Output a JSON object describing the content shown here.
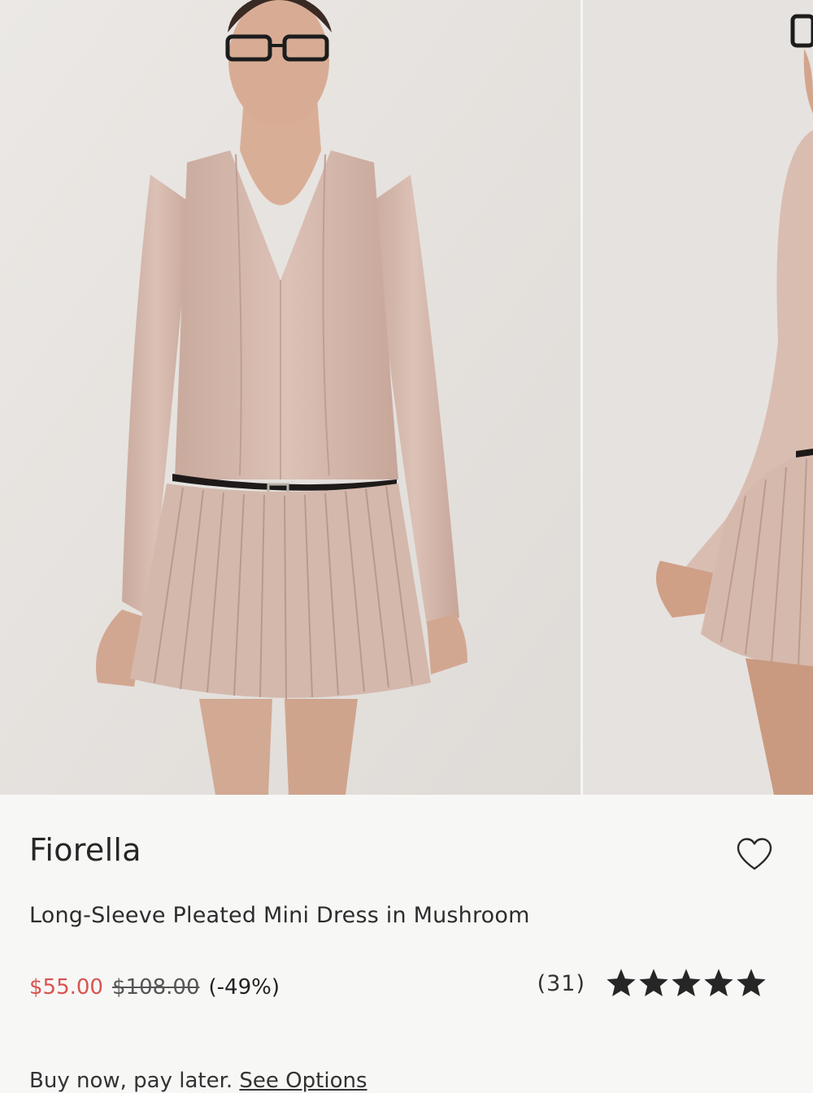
{
  "gallery": {
    "images": [
      {
        "label": "product-photo-front"
      },
      {
        "label": "product-photo-side"
      }
    ]
  },
  "product": {
    "brand": "Fiorella",
    "name": "Long-Sleeve Pleated Mini Dress in Mushroom",
    "price_sale": "$55.00",
    "price_original": "$108.00",
    "discount": "(-49%)",
    "review_count": "(31)",
    "rating": 5,
    "rating_max": 5,
    "wishlist_icon": "heart-outline-icon"
  },
  "payment": {
    "bnpl_text": "Buy now, pay later.",
    "options_link": "See Options"
  },
  "colors": {
    "sale": "#d9534f",
    "text": "#1f1f1f",
    "dress": "#d7bcb1",
    "background": "#f7f7f6"
  }
}
